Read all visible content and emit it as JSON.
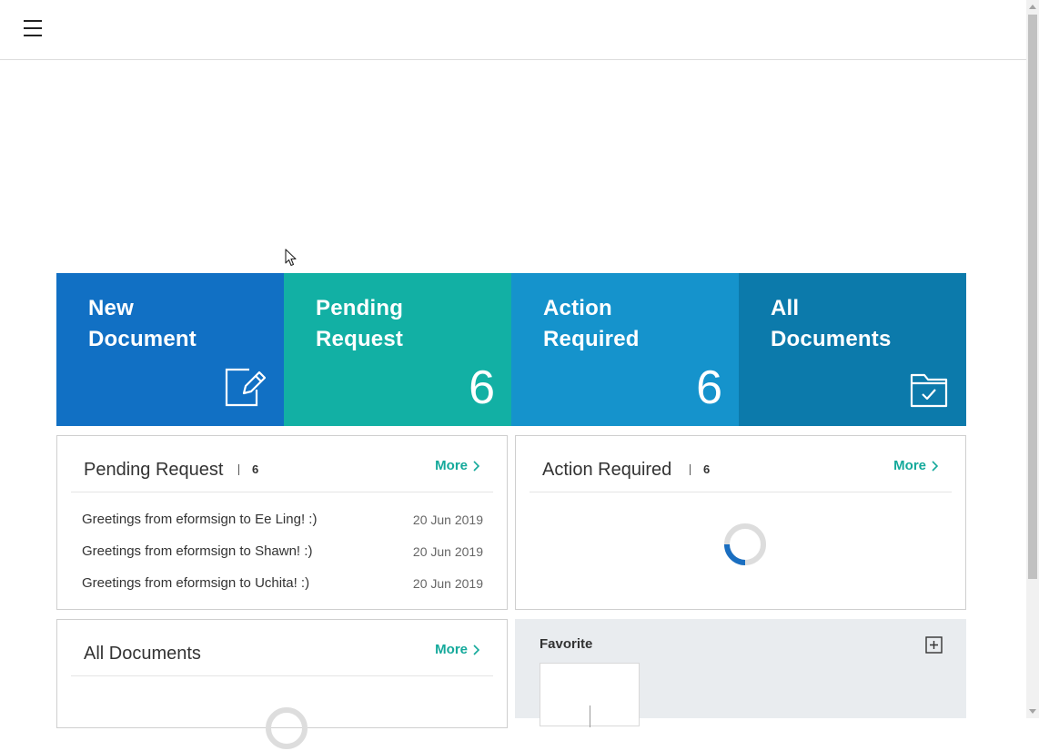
{
  "header": {
    "menu_icon": "hamburger-menu-icon"
  },
  "tiles": [
    {
      "title": "New\nDocument",
      "count": null,
      "icon": "edit-document-icon",
      "color": "#1170c4"
    },
    {
      "title": "Pending\nRequest",
      "count": "6",
      "icon": null,
      "color": "#12b0a4"
    },
    {
      "title": "Action\nRequired",
      "count": "6",
      "icon": null,
      "color": "#1593cc"
    },
    {
      "title": "All\nDocuments",
      "count": null,
      "icon": "folder-check-icon",
      "color": "#0c7aab"
    }
  ],
  "pending_panel": {
    "title": "Pending Request",
    "count": "6",
    "more_label": "More",
    "items": [
      {
        "title": "Greetings from eformsign to Ee Ling! :)",
        "date": "20 Jun 2019"
      },
      {
        "title": "Greetings from eformsign to Shawn! :)",
        "date": "20 Jun 2019"
      },
      {
        "title": "Greetings from eformsign to Uchita! :)",
        "date": "20 Jun 2019"
      }
    ]
  },
  "action_panel": {
    "title": "Action Required",
    "count": "6",
    "more_label": "More",
    "state": "loading"
  },
  "all_docs_panel": {
    "title": "All Documents",
    "more_label": "More",
    "state": "loading"
  },
  "favorite": {
    "title": "Favorite",
    "add_icon": "plus-square-icon"
  },
  "colors": {
    "accent": "#14a99b",
    "spinner_track": "#dddddd",
    "spinner_arc": "#1a6ec0"
  }
}
